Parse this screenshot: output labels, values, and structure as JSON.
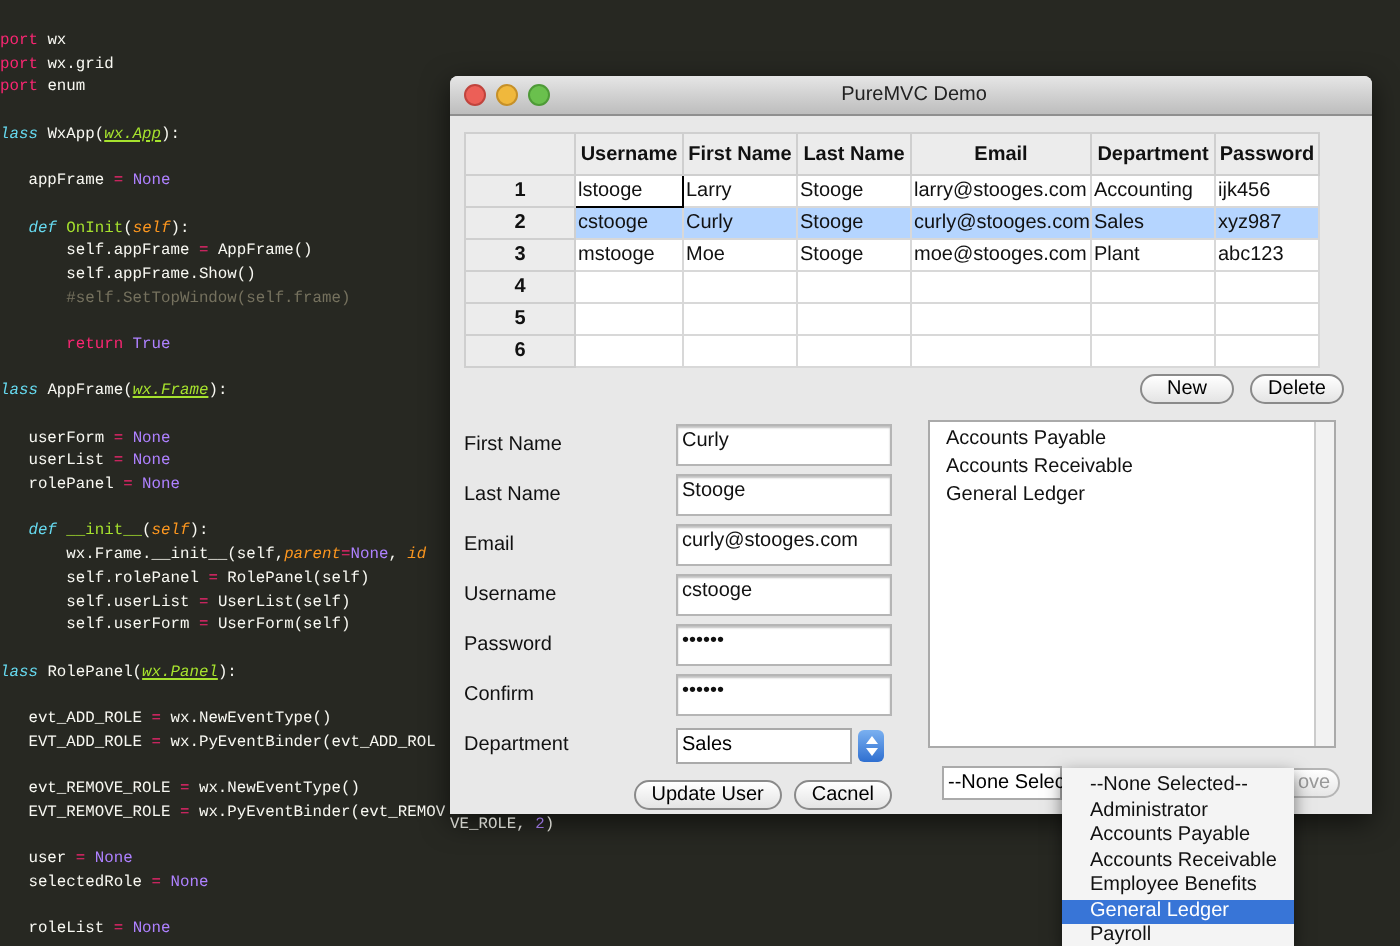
{
  "editor": {
    "lines": [
      {
        "kind": "code",
        "tokens": [
          {
            "t": "port",
            "kind": "kw"
          },
          {
            "t": " wx",
            "kind": "txt"
          }
        ]
      },
      {
        "kind": "code",
        "tokens": [
          {
            "t": "port",
            "kind": "kw"
          },
          {
            "t": " wx.grid",
            "kind": "txt"
          }
        ]
      },
      {
        "kind": "code",
        "tokens": [
          {
            "t": "port",
            "kind": "kw"
          },
          {
            "t": " enum",
            "kind": "txt"
          }
        ]
      },
      {
        "kind": "blank"
      },
      {
        "kind": "code",
        "tokens": [
          {
            "t": "lass",
            "kind": "def"
          },
          {
            "t": " WxApp(",
            "kind": "txt"
          },
          {
            "t": "wx.App",
            "kind": "base"
          },
          {
            "t": "):",
            "kind": "txt"
          }
        ]
      },
      {
        "kind": "blank"
      },
      {
        "kind": "code",
        "tokens": [
          {
            "t": "   appFrame ",
            "kind": "txt"
          },
          {
            "t": "=",
            "kind": "kw"
          },
          {
            "t": " None",
            "kind": "const"
          }
        ]
      },
      {
        "kind": "blank"
      },
      {
        "kind": "code",
        "tokens": [
          {
            "t": "   def ",
            "kind": "def"
          },
          {
            "t": "OnInit",
            "kind": "fn"
          },
          {
            "t": "(",
            "kind": "txt"
          },
          {
            "t": "self",
            "kind": "param"
          },
          {
            "t": "):",
            "kind": "txt"
          }
        ]
      },
      {
        "kind": "code",
        "tokens": [
          {
            "t": "       self.appFrame ",
            "kind": "txt"
          },
          {
            "t": "=",
            "kind": "kw"
          },
          {
            "t": " AppFrame()",
            "kind": "txt"
          }
        ]
      },
      {
        "kind": "code",
        "tokens": [
          {
            "t": "       self.appFrame.Show()",
            "kind": "txt"
          }
        ]
      },
      {
        "kind": "code",
        "tokens": [
          {
            "t": "       #self.SetTopWindow(self.frame)",
            "kind": "comment"
          }
        ]
      },
      {
        "kind": "blank"
      },
      {
        "kind": "code",
        "tokens": [
          {
            "t": "       return",
            "kind": "kw"
          },
          {
            "t": " True",
            "kind": "const"
          }
        ]
      },
      {
        "kind": "blank"
      },
      {
        "kind": "code",
        "tokens": [
          {
            "t": "lass",
            "kind": "def"
          },
          {
            "t": " AppFrame(",
            "kind": "txt"
          },
          {
            "t": "wx.Frame",
            "kind": "base"
          },
          {
            "t": "):",
            "kind": "txt"
          }
        ]
      },
      {
        "kind": "blank"
      },
      {
        "kind": "code",
        "tokens": [
          {
            "t": "   userForm ",
            "kind": "txt"
          },
          {
            "t": "=",
            "kind": "kw"
          },
          {
            "t": " None",
            "kind": "const"
          }
        ]
      },
      {
        "kind": "code",
        "tokens": [
          {
            "t": "   userList ",
            "kind": "txt"
          },
          {
            "t": "=",
            "kind": "kw"
          },
          {
            "t": " None",
            "kind": "const"
          }
        ]
      },
      {
        "kind": "code",
        "tokens": [
          {
            "t": "   rolePanel ",
            "kind": "txt"
          },
          {
            "t": "=",
            "kind": "kw"
          },
          {
            "t": " None",
            "kind": "const"
          }
        ]
      },
      {
        "kind": "blank"
      },
      {
        "kind": "code",
        "tokens": [
          {
            "t": "   def ",
            "kind": "def"
          },
          {
            "t": "__init__",
            "kind": "fn"
          },
          {
            "t": "(",
            "kind": "txt"
          },
          {
            "t": "self",
            "kind": "param"
          },
          {
            "t": "):",
            "kind": "txt"
          }
        ]
      },
      {
        "kind": "code",
        "tokens": [
          {
            "t": "       wx.Frame.__init__(self,",
            "kind": "txt"
          },
          {
            "t": "parent",
            "kind": "param"
          },
          {
            "t": "=",
            "kind": "kw"
          },
          {
            "t": "None",
            "kind": "const"
          },
          {
            "t": ", ",
            "kind": "txt"
          },
          {
            "t": "id",
            "kind": "param"
          }
        ]
      },
      {
        "kind": "code",
        "tokens": [
          {
            "t": "       self.rolePanel ",
            "kind": "txt"
          },
          {
            "t": "=",
            "kind": "kw"
          },
          {
            "t": " RolePanel(self)",
            "kind": "txt"
          }
        ]
      },
      {
        "kind": "code",
        "tokens": [
          {
            "t": "       self.userList ",
            "kind": "txt"
          },
          {
            "t": "=",
            "kind": "kw"
          },
          {
            "t": " UserList(self)",
            "kind": "txt"
          }
        ]
      },
      {
        "kind": "code",
        "tokens": [
          {
            "t": "       self.userForm ",
            "kind": "txt"
          },
          {
            "t": "=",
            "kind": "kw"
          },
          {
            "t": " UserForm(self)",
            "kind": "txt"
          }
        ]
      },
      {
        "kind": "blank"
      },
      {
        "kind": "code",
        "tokens": [
          {
            "t": "lass",
            "kind": "def"
          },
          {
            "t": " RolePanel(",
            "kind": "txt"
          },
          {
            "t": "wx.Panel",
            "kind": "base"
          },
          {
            "t": "):",
            "kind": "txt"
          }
        ]
      },
      {
        "kind": "blank"
      },
      {
        "kind": "code",
        "tokens": [
          {
            "t": "   evt_ADD_ROLE ",
            "kind": "txt"
          },
          {
            "t": "=",
            "kind": "kw"
          },
          {
            "t": " wx.NewEventType()",
            "kind": "txt"
          }
        ]
      },
      {
        "kind": "code",
        "tokens": [
          {
            "t": "   EVT_ADD_ROLE ",
            "kind": "txt"
          },
          {
            "t": "=",
            "kind": "kw"
          },
          {
            "t": " wx.PyEventBinder(evt_ADD_ROL",
            "kind": "txt"
          }
        ]
      },
      {
        "kind": "blank"
      },
      {
        "kind": "code",
        "tokens": [
          {
            "t": "   evt_REMOVE_ROLE ",
            "kind": "txt"
          },
          {
            "t": "=",
            "kind": "kw"
          },
          {
            "t": " wx.NewEventType()",
            "kind": "txt"
          }
        ]
      },
      {
        "kind": "code",
        "tokens": [
          {
            "t": "   EVT_REMOVE_ROLE ",
            "kind": "txt"
          },
          {
            "t": "=",
            "kind": "kw"
          },
          {
            "t": " wx.PyEventBinder(evt_REMOV",
            "kind": "txt"
          }
        ]
      },
      {
        "kind": "blank"
      },
      {
        "kind": "code",
        "tokens": [
          {
            "t": "   user ",
            "kind": "txt"
          },
          {
            "t": "=",
            "kind": "kw"
          },
          {
            "t": " None",
            "kind": "const"
          }
        ]
      },
      {
        "kind": "code",
        "tokens": [
          {
            "t": "   selectedRole ",
            "kind": "txt"
          },
          {
            "t": "=",
            "kind": "kw"
          },
          {
            "t": " None",
            "kind": "const"
          }
        ]
      },
      {
        "kind": "blank"
      },
      {
        "kind": "code",
        "tokens": [
          {
            "t": "   roleList ",
            "kind": "txt"
          },
          {
            "t": "=",
            "kind": "kw"
          },
          {
            "t": " None",
            "kind": "const"
          }
        ]
      }
    ],
    "overflow_tokens": [
      {
        "t": "VE_ROLE, ",
        "kind": "txt"
      },
      {
        "t": "2",
        "kind": "const"
      },
      {
        "t": ")",
        "kind": "txt"
      }
    ]
  },
  "window": {
    "title": "PureMVC Demo",
    "table": {
      "columns": [
        "Username",
        "First Name",
        "Last Name",
        "Email",
        "Department",
        "Password"
      ],
      "rows": [
        {
          "number": "1",
          "selected": false,
          "cursor": true,
          "cells": [
            "lstooge",
            "Larry",
            "Stooge",
            "larry@stooges.com",
            "Accounting",
            "ijk456"
          ]
        },
        {
          "number": "2",
          "selected": true,
          "cursor": false,
          "cells": [
            "cstooge",
            "Curly",
            "Stooge",
            "curly@stooges.com",
            "Sales",
            "xyz987"
          ]
        },
        {
          "number": "3",
          "selected": false,
          "cursor": false,
          "cells": [
            "mstooge",
            "Moe",
            "Stooge",
            "moe@stooges.com",
            "Plant",
            "abc123"
          ]
        },
        {
          "number": "4",
          "selected": false,
          "cursor": false
        },
        {
          "number": "5",
          "selected": false,
          "cursor": false
        },
        {
          "number": "6",
          "selected": false,
          "cursor": false
        }
      ]
    },
    "table_buttons": [
      "New",
      "Delete"
    ],
    "form": {
      "fields": [
        {
          "label": "First Name",
          "value": "Curly",
          "kind": "text"
        },
        {
          "label": "Last Name",
          "value": "Stooge",
          "kind": "text"
        },
        {
          "label": "Email",
          "value": "curly@stooges.com",
          "kind": "text"
        },
        {
          "label": "Username",
          "value": "cstooge",
          "kind": "text"
        },
        {
          "label": "Password",
          "value": "••••••",
          "kind": "text"
        },
        {
          "label": "Confirm",
          "value": "••••••",
          "kind": "text"
        },
        {
          "label": "Department",
          "value": "Sales",
          "kind": "select"
        }
      ],
      "buttons": [
        "Update User",
        "Cacnel"
      ]
    },
    "roles_list": {
      "items": [
        "Accounts Payable",
        "Accounts Receivable",
        "General Ledger"
      ]
    },
    "role_select": {
      "value": "--None Selec"
    },
    "remove_button": "ove",
    "dropdown": {
      "options": [
        {
          "label": "--None Selected--",
          "selected": false
        },
        {
          "label": "Administrator",
          "selected": false
        },
        {
          "label": "Accounts Payable",
          "selected": false
        },
        {
          "label": "Accounts Receivable",
          "selected": false
        },
        {
          "label": "Employee Benefits",
          "selected": false
        },
        {
          "label": "General Ledger",
          "selected": true
        },
        {
          "label": "Payroll",
          "selected": false
        }
      ]
    }
  }
}
